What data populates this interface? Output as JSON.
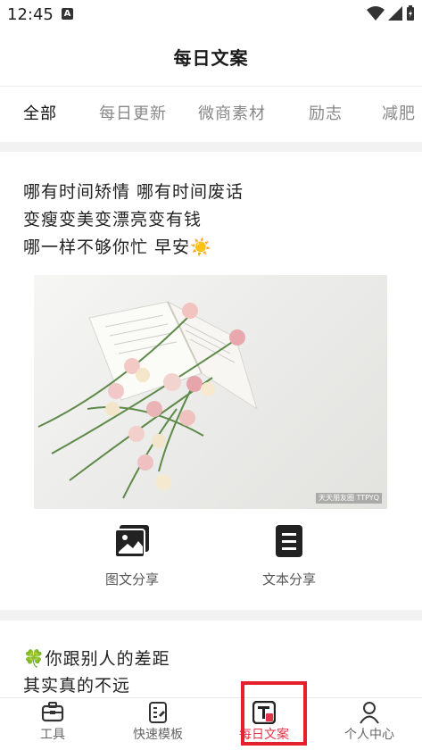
{
  "status_bar": {
    "time": "12:45",
    "notification_badge": "A"
  },
  "app_bar": {
    "title": "每日文案"
  },
  "tabs": [
    {
      "label": "全部",
      "active": true
    },
    {
      "label": "每日更新",
      "active": false
    },
    {
      "label": "微商素材",
      "active": false
    },
    {
      "label": "励志",
      "active": false
    },
    {
      "label": "减肥",
      "active": false
    }
  ],
  "post1": {
    "lines": [
      "哪有时间矫情 哪有时间废话",
      "变瘦变美变漂亮变有钱",
      "哪一样不够你忙 早安☀️"
    ],
    "image_watermark": "天天朋友圈\nTTPYQ"
  },
  "share": {
    "image_text_label": "图文分享",
    "text_label": "文本分享"
  },
  "post2": {
    "lines": [
      "🍀你跟别人的差距",
      "其实真的不远"
    ]
  },
  "bottom_nav": [
    {
      "label": "工具",
      "icon": "toolbox-icon"
    },
    {
      "label": "快速模板",
      "icon": "template-icon"
    },
    {
      "label": "每日文案",
      "icon": "daily-copy-icon",
      "active": true
    },
    {
      "label": "个人中心",
      "icon": "person-icon"
    }
  ],
  "colors": {
    "accent": "#e4324b",
    "highlight_box": "#e3202c"
  }
}
